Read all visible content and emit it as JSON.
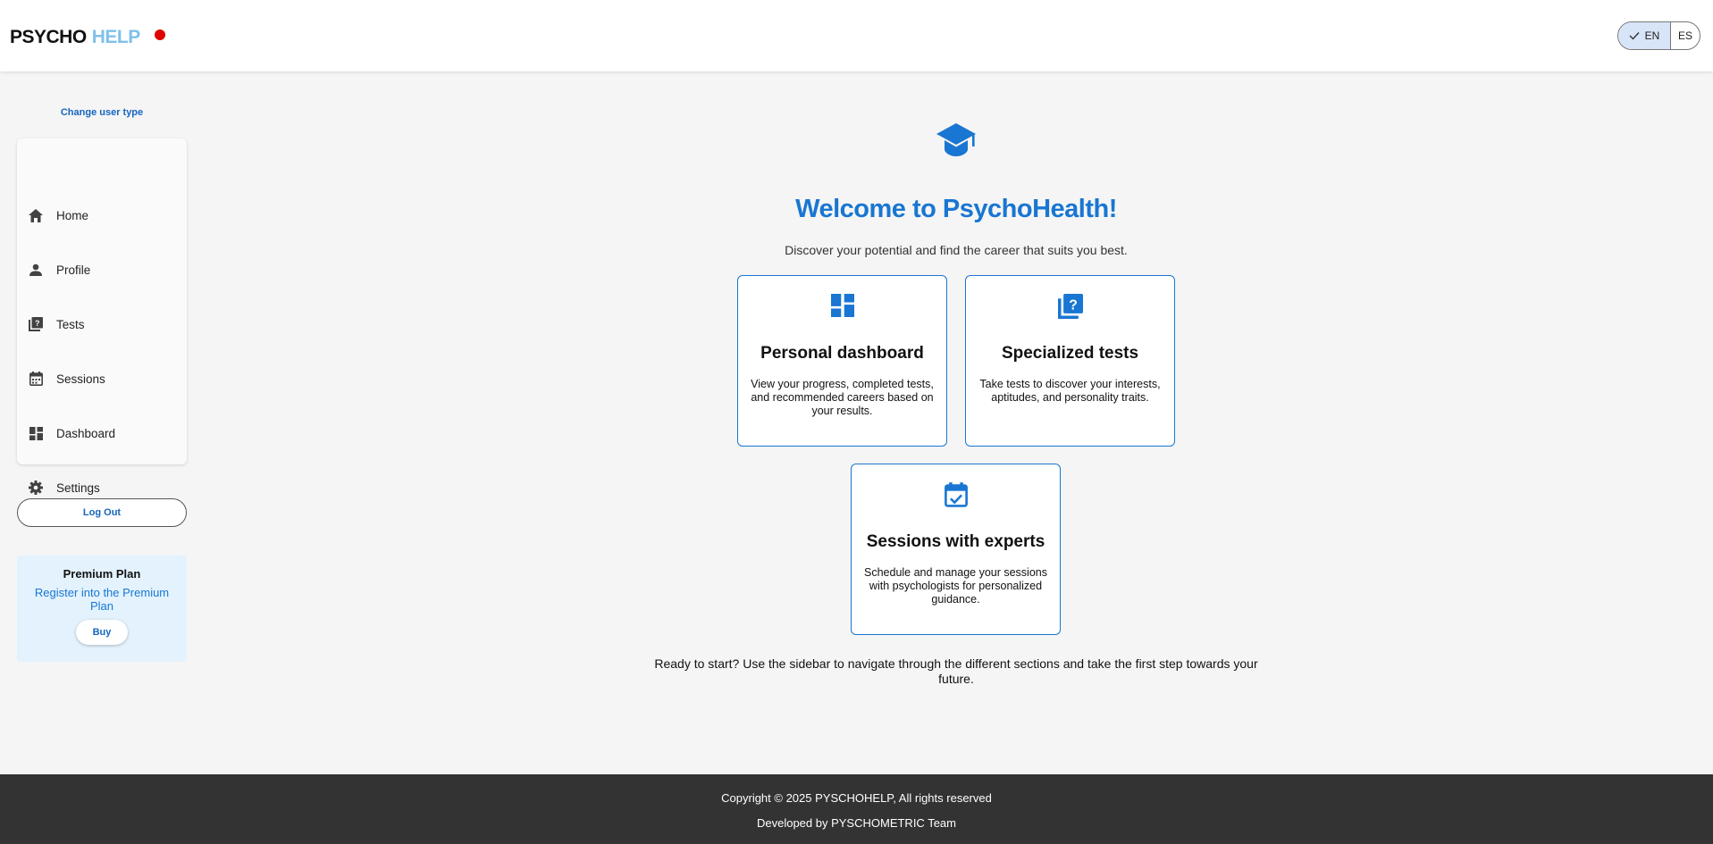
{
  "header": {
    "brand_part1": "PSYCHO",
    "brand_part2": "HELP",
    "lang_en": "EN",
    "lang_es": "ES",
    "lang_selected": "EN"
  },
  "sidebar": {
    "change_user": "Change user type",
    "items": [
      {
        "label": "Home",
        "icon": "home-icon"
      },
      {
        "label": "Profile",
        "icon": "person-icon"
      },
      {
        "label": "Tests",
        "icon": "quiz-icon"
      },
      {
        "label": "Sessions",
        "icon": "calendar-icon"
      },
      {
        "label": "Dashboard",
        "icon": "dashboard-icon"
      },
      {
        "label": "Settings",
        "icon": "gear-icon"
      }
    ],
    "logout": "Log Out",
    "premium": {
      "title": "Premium Plan",
      "text": "Register into the Premium Plan",
      "button": "Buy"
    }
  },
  "main": {
    "icon": "graduation-cap-icon",
    "title": "Welcome to PsychoHealth!",
    "subtitle": "Discover your potential and find the career that suits you best.",
    "cards": [
      {
        "icon": "dashboard-icon",
        "title": "Personal dashboard",
        "text": "View your progress, completed tests, and recommended careers based on your results."
      },
      {
        "icon": "quiz-icon",
        "title": "Specialized tests",
        "text": "Take tests to discover your interests, aptitudes, and personality traits."
      },
      {
        "icon": "event-available-icon",
        "title": "Sessions with experts",
        "text": "Schedule and manage your sessions with psychologists for personalized guidance."
      }
    ],
    "ready": "Ready to start? Use the sidebar to navigate through the different sections and take the first step towards your future."
  },
  "footer": {
    "copyright": "Copyright © 2025 PYSCHOHELP, All rights reserved",
    "developed": "Developed by PYSCHOMETRIC Team"
  },
  "colors": {
    "accent": "#1976d2",
    "brand_light": "#7fc1ea",
    "status_dot": "#e00000",
    "footer_bg": "#333333"
  }
}
